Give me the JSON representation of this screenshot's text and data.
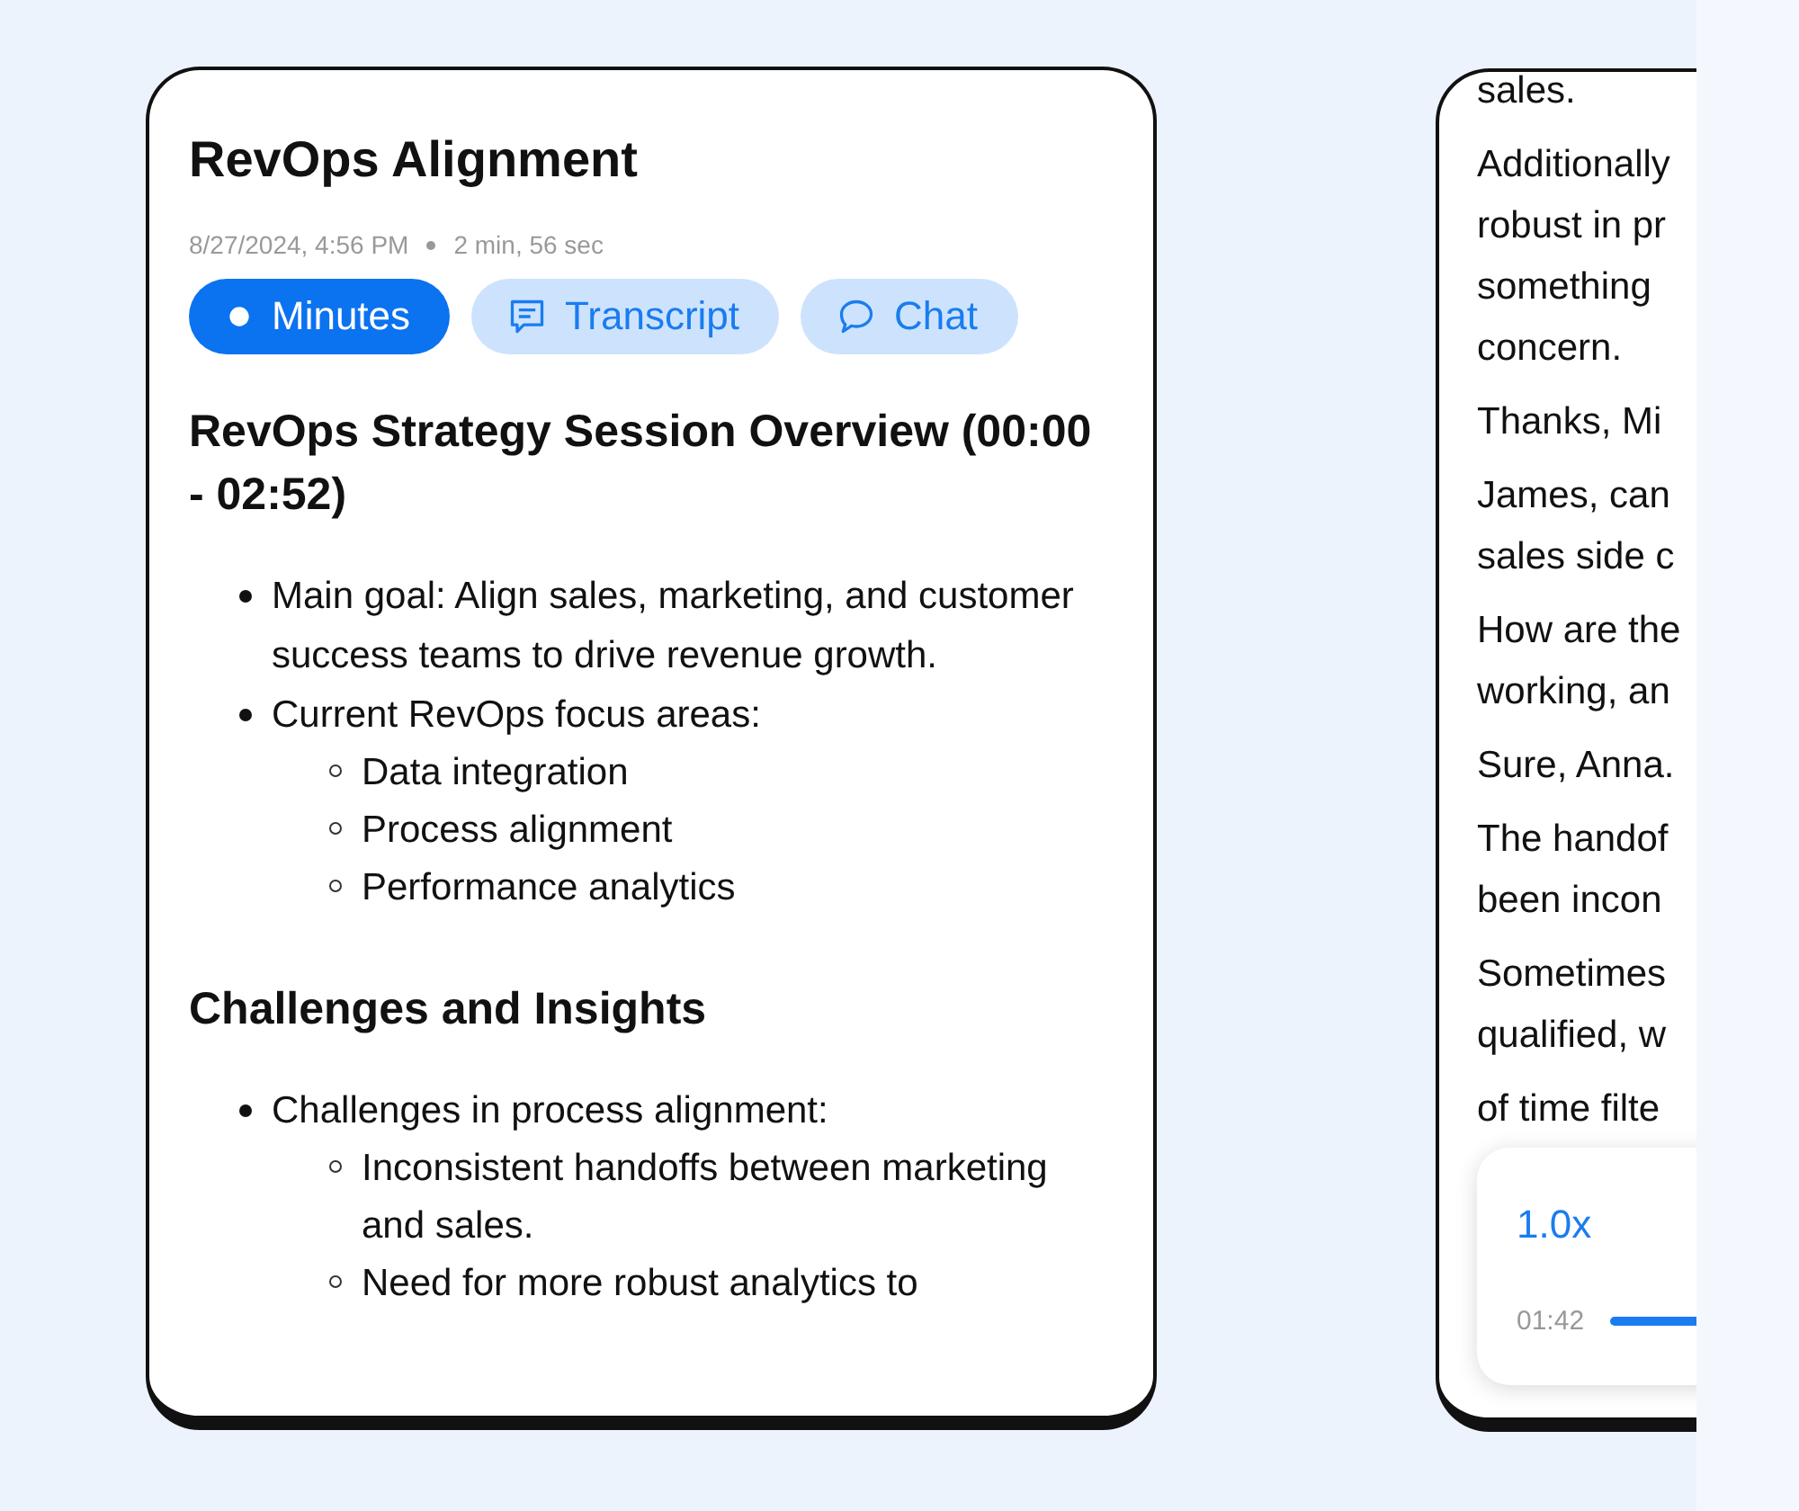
{
  "minutes_card": {
    "title": "RevOps Alignment",
    "date": "8/27/2024, 4:56 PM",
    "duration": "2 min, 56 sec",
    "tabs": [
      {
        "label": "Minutes",
        "kind": "dot",
        "selected": true
      },
      {
        "label": "Transcript",
        "kind": "transcript",
        "selected": false
      },
      {
        "label": "Chat",
        "kind": "chat",
        "selected": false
      }
    ],
    "sections": [
      {
        "heading": "RevOps Strategy Session Overview (00:00 - 02:52)",
        "items": [
          {
            "text": "Main goal: Align sales, marketing, and customer success teams to drive revenue growth."
          },
          {
            "text": "Current RevOps focus areas:",
            "children": [
              {
                "text": "Data integration"
              },
              {
                "text": "Process alignment"
              },
              {
                "text": "Performance analytics"
              }
            ]
          }
        ]
      },
      {
        "heading": "Challenges and Insights",
        "items": [
          {
            "text": "Challenges in process alignment:",
            "children": [
              {
                "text": "Inconsistent handoffs between marketing and sales."
              },
              {
                "text": "Need for more robust analytics to"
              }
            ]
          }
        ]
      }
    ]
  },
  "transcript_card": {
    "paragraphs": [
      {
        "lines": [
          "sales."
        ]
      },
      {
        "lines": [
          "Additionally",
          "robust in pr",
          "something",
          "concern."
        ]
      },
      {
        "lines": [
          "Thanks, Mi"
        ]
      },
      {
        "lines": [
          "James, can",
          "sales side c"
        ]
      },
      {
        "lines": [
          "How are the",
          "working, an"
        ]
      },
      {
        "lines": [
          "Sure, Anna."
        ]
      },
      {
        "lines": [
          "The handof",
          "been incon"
        ]
      },
      {
        "lines": [
          "Sometimes",
          "qualified, w"
        ]
      },
      {
        "lines": [
          "of time filte"
        ]
      }
    ],
    "player": {
      "speed": "1.0x",
      "time": "01:42"
    }
  }
}
